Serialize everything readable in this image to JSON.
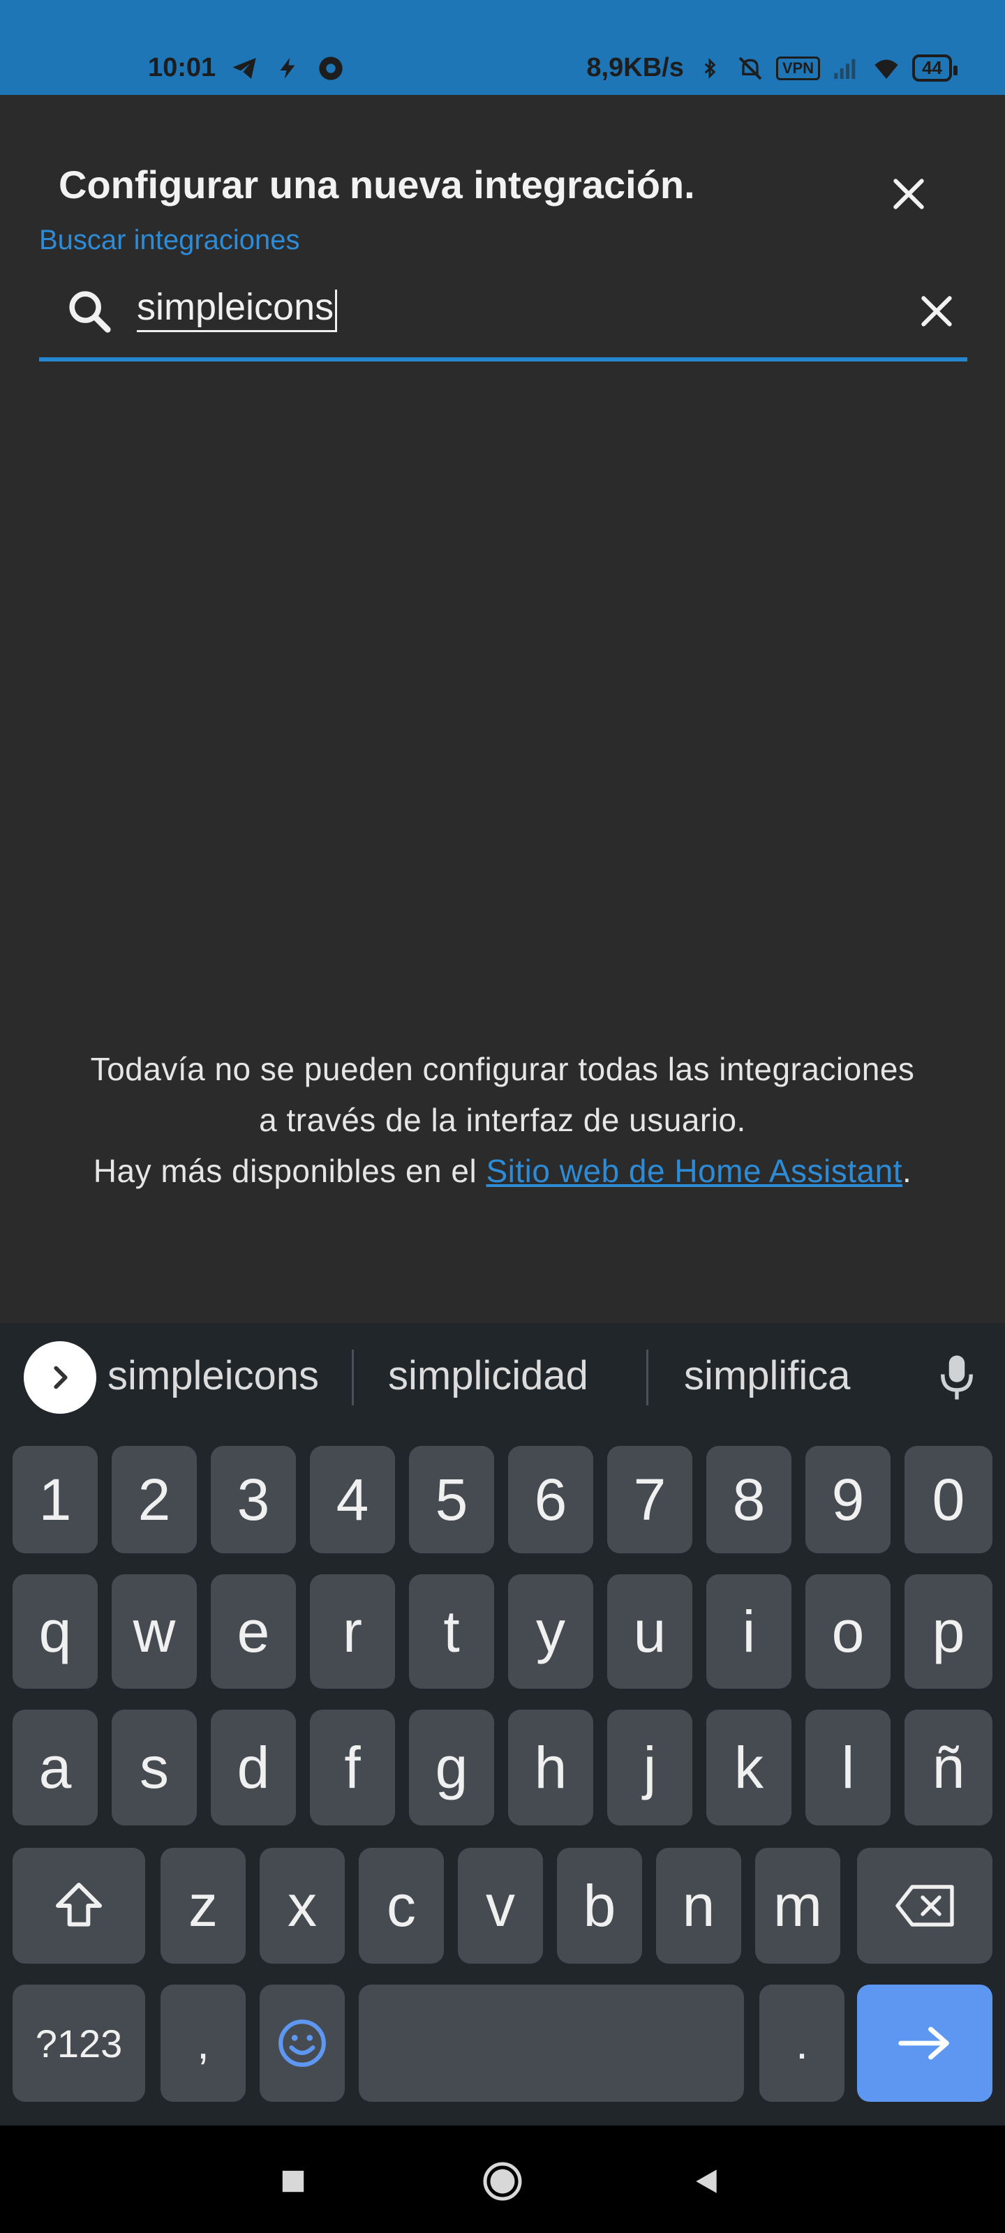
{
  "status_bar": {
    "time": "10:01",
    "net_speed": "8,9KB/s",
    "vpn_label": "VPN",
    "battery": "44"
  },
  "dialog": {
    "title": "Configurar una nueva integración.",
    "search_label": "Buscar integraciones",
    "search_value": "simpleicons"
  },
  "info": {
    "line1": "Todavía no se pueden configurar todas las integraciones",
    "line2": "a través de la interfaz de usuario.",
    "line3_prefix": "Hay más disponibles en el ",
    "link_text": "Sitio web de Home Assistant",
    "line3_suffix": "."
  },
  "keyboard": {
    "suggestions": [
      "simpleicons",
      "simplicidad",
      "simplifica"
    ],
    "row_numbers": [
      "1",
      "2",
      "3",
      "4",
      "5",
      "6",
      "7",
      "8",
      "9",
      "0"
    ],
    "row1": [
      "q",
      "w",
      "e",
      "r",
      "t",
      "y",
      "u",
      "i",
      "o",
      "p"
    ],
    "row2": [
      "a",
      "s",
      "d",
      "f",
      "g",
      "h",
      "j",
      "k",
      "l",
      "ñ"
    ],
    "row3": [
      "z",
      "x",
      "c",
      "v",
      "b",
      "n",
      "m"
    ],
    "symbols_label": "?123",
    "comma": ",",
    "period": "."
  },
  "colors": {
    "accent": "#2686cf",
    "status_bar": "#1f76b6",
    "background": "#2b2b2b",
    "key": "#454b50",
    "action_key": "#5e97f2"
  },
  "icons": {
    "close": "close-icon",
    "search": "search-icon",
    "clear": "clear-icon",
    "mic": "microphone-icon",
    "shift": "shift-icon",
    "backspace": "backspace-icon",
    "emoji": "emoji-icon",
    "enter": "arrow-right-icon"
  }
}
